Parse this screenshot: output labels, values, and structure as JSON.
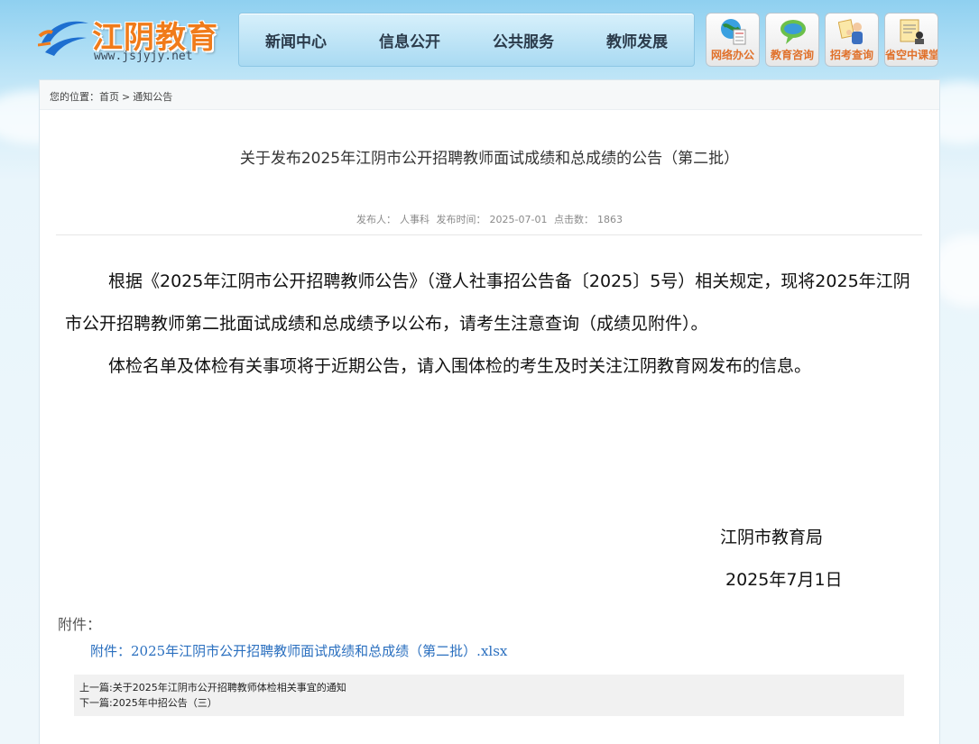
{
  "site": {
    "name": "江阴教育",
    "url": "www.jsjyjy.net"
  },
  "nav": {
    "items": [
      "新闻中心",
      "信息公开",
      "公共服务",
      "教师发展"
    ]
  },
  "shortcuts": [
    {
      "label": "网络办公",
      "icon": "globe-doc-icon"
    },
    {
      "label": "教育咨询",
      "icon": "chat-bubble-icon"
    },
    {
      "label": "招考查询",
      "icon": "people-search-icon"
    },
    {
      "label": "省空中课堂",
      "icon": "classroom-icon"
    }
  ],
  "breadcrumb": {
    "prefix": "您的位置：",
    "home": "首页",
    "separator": ">",
    "current": "通知公告"
  },
  "article": {
    "title": "关于发布2025年江阴市公开招聘教师面试成绩和总成绩的公告（第二批）",
    "meta": {
      "publisher_label": "发布人：",
      "publisher": "人事科",
      "time_label": "发布时间：",
      "time": "2025-07-01",
      "clicks_label": "点击数：",
      "clicks": "1863"
    },
    "paragraphs": [
      "根据《2025年江阴市公开招聘教师公告》（澄人社事招公告备〔2025〕5号）相关规定，现将2025年江阴市公开招聘教师第二批面试成绩和总成绩予以公布，请考生注意查询（成绩见附件）。",
      "体检名单及体检有关事项将于近期公告，请入围体检的考生及时关注江阴教育网发布的信息。"
    ],
    "signature": {
      "org": "江阴市教育局",
      "date": "2025年7月1日"
    },
    "attachments": {
      "label": "附件：",
      "items": [
        "附件：2025年江阴市公开招聘教师面试成绩和总成绩（第二批）.xlsx"
      ]
    }
  },
  "prevnext": {
    "prev": "上一篇:关于2025年江阴市公开招聘教师体检相关事宜的通知",
    "next": "下一篇:2025年中招公告（三）"
  },
  "colors": {
    "logo_orange": "#f07b1a",
    "link_blue": "#2a6fbf",
    "nav_bg": "#a9daf2"
  }
}
